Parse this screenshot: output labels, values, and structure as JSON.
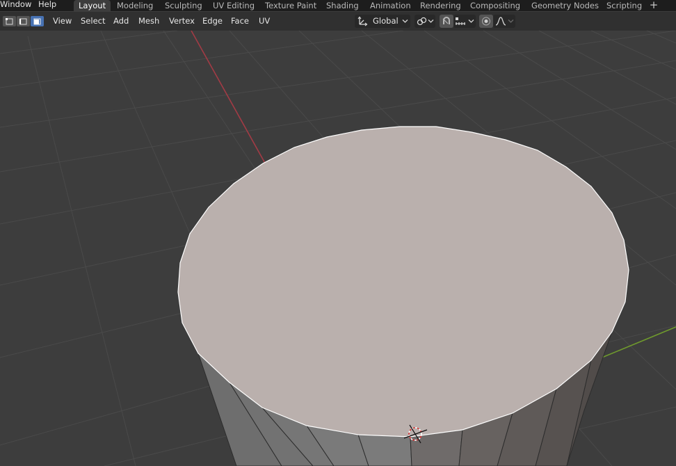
{
  "menubar": {
    "items": [
      "Window",
      "Help"
    ]
  },
  "workspaces": {
    "tabs": [
      "Layout",
      "Modeling",
      "Sculpting",
      "UV Editing",
      "Texture Paint",
      "Shading",
      "Animation",
      "Rendering",
      "Compositing",
      "Geometry Nodes",
      "Scripting"
    ],
    "active": "Layout",
    "add_icon": "plus-icon"
  },
  "viewport_header": {
    "select_modes": [
      {
        "icon": "vertex-select-icon",
        "active": false
      },
      {
        "icon": "edge-select-icon",
        "active": false
      },
      {
        "icon": "face-select-icon",
        "active": true
      }
    ],
    "menus": [
      "View",
      "Select",
      "Add",
      "Mesh",
      "Vertex",
      "Edge",
      "Face",
      "UV"
    ],
    "transform_orientation": {
      "icon": "orientation-gizmo-icon",
      "value": "Global"
    },
    "pivot_icon": "pivot-point-icon",
    "snap_icon": "snap-magnet-icon",
    "snap_target_icon": "snap-increment-icon",
    "proportional_icon": "proportional-editing-icon",
    "falloff_icon": "falloff-curve-icon"
  },
  "viewport": {
    "background": "#3d3d3d",
    "grid_color": "#4d4d4d",
    "x_axis_color": "#a23b45",
    "y_axis_color": "#6f9a2d",
    "selected_face_color": "#bab0ad",
    "object": "cylinder (edit mode, top face selected)",
    "cursor_icon": "3d-cursor-icon"
  }
}
